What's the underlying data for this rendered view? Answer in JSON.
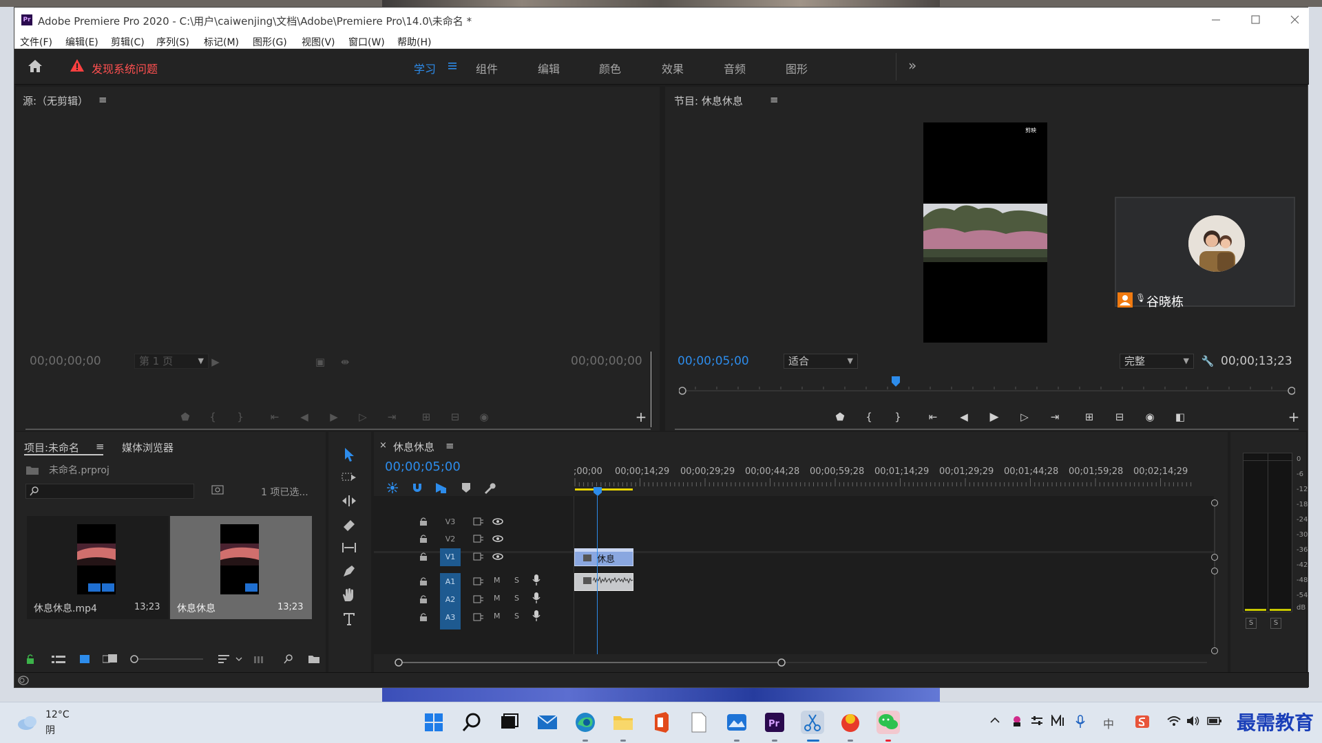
{
  "window": {
    "title": "Adobe Premiere Pro 2020 - C:\\用户\\caiwenjing\\文档\\Adobe\\Premiere Pro\\14.0\\未命名 *",
    "app_icon": "Pr"
  },
  "menu": [
    "文件(F)",
    "编辑(E)",
    "剪辑(C)",
    "序列(S)",
    "标记(M)",
    "图形(G)",
    "视图(V)",
    "窗口(W)",
    "帮助(H)"
  ],
  "header": {
    "alert": "发现系统问题",
    "workspaces": [
      "学习",
      "组件",
      "编辑",
      "颜色",
      "效果",
      "音频",
      "图形"
    ],
    "active_workspace": "学习",
    "overflow": "»"
  },
  "source_monitor": {
    "title": "源:（无剪辑）",
    "tc_left": "00;00;00;00",
    "tc_right": "00;00;00;00",
    "page": "第 1 页"
  },
  "program_monitor": {
    "title": "节目: 休息休息",
    "tc_current": "00;00;05;00",
    "fit": "适合",
    "quality": "完整",
    "tc_duration": "00;00;13;23",
    "watermark": "剪映",
    "playhead_fraction": 0.35
  },
  "project": {
    "tab_project": "项目:未命名",
    "tab_media": "媒体浏览器",
    "file": "未命名.prproj",
    "selection": "1 项已选...",
    "search_placeholder": "",
    "items": [
      {
        "name": "休息休息.mp4",
        "duration": "13;23"
      },
      {
        "name": "休息休息",
        "duration": "13;23"
      }
    ]
  },
  "timeline": {
    "tab": "休息休息",
    "close": "×",
    "tc": "00;00;05;00",
    "ruler": [
      ";00;00",
      "00;00;14;29",
      "00;00;29;29",
      "00;00;44;28",
      "00;00;59;28",
      "00;01;14;29",
      "00;01;29;29",
      "00;01;44;28",
      "00;01;59;28",
      "00;02;14;29"
    ],
    "video_tracks": [
      "V3",
      "V2",
      "V1"
    ],
    "audio_tracks": [
      "A1",
      "A2",
      "A3"
    ],
    "clip_label": "休息",
    "m_label": "M",
    "s_label": "S"
  },
  "audio_meter": {
    "scale": [
      "0",
      "-6",
      "-12",
      "-18",
      "-24",
      "-30",
      "-36",
      "-42",
      "-48",
      "-54",
      "dB"
    ],
    "solo": [
      "S",
      "S"
    ]
  },
  "video_call": {
    "name": "谷晓栋"
  },
  "taskbar": {
    "weather_temp": "12°C",
    "weather_desc": "阴",
    "ime": "中",
    "brand": "最需教育"
  },
  "colors": {
    "accent": "#2d8ceb",
    "alert": "#ff5050",
    "panel": "#232323",
    "track_on": "#1e5a90",
    "clip": "#6b8fd4"
  }
}
